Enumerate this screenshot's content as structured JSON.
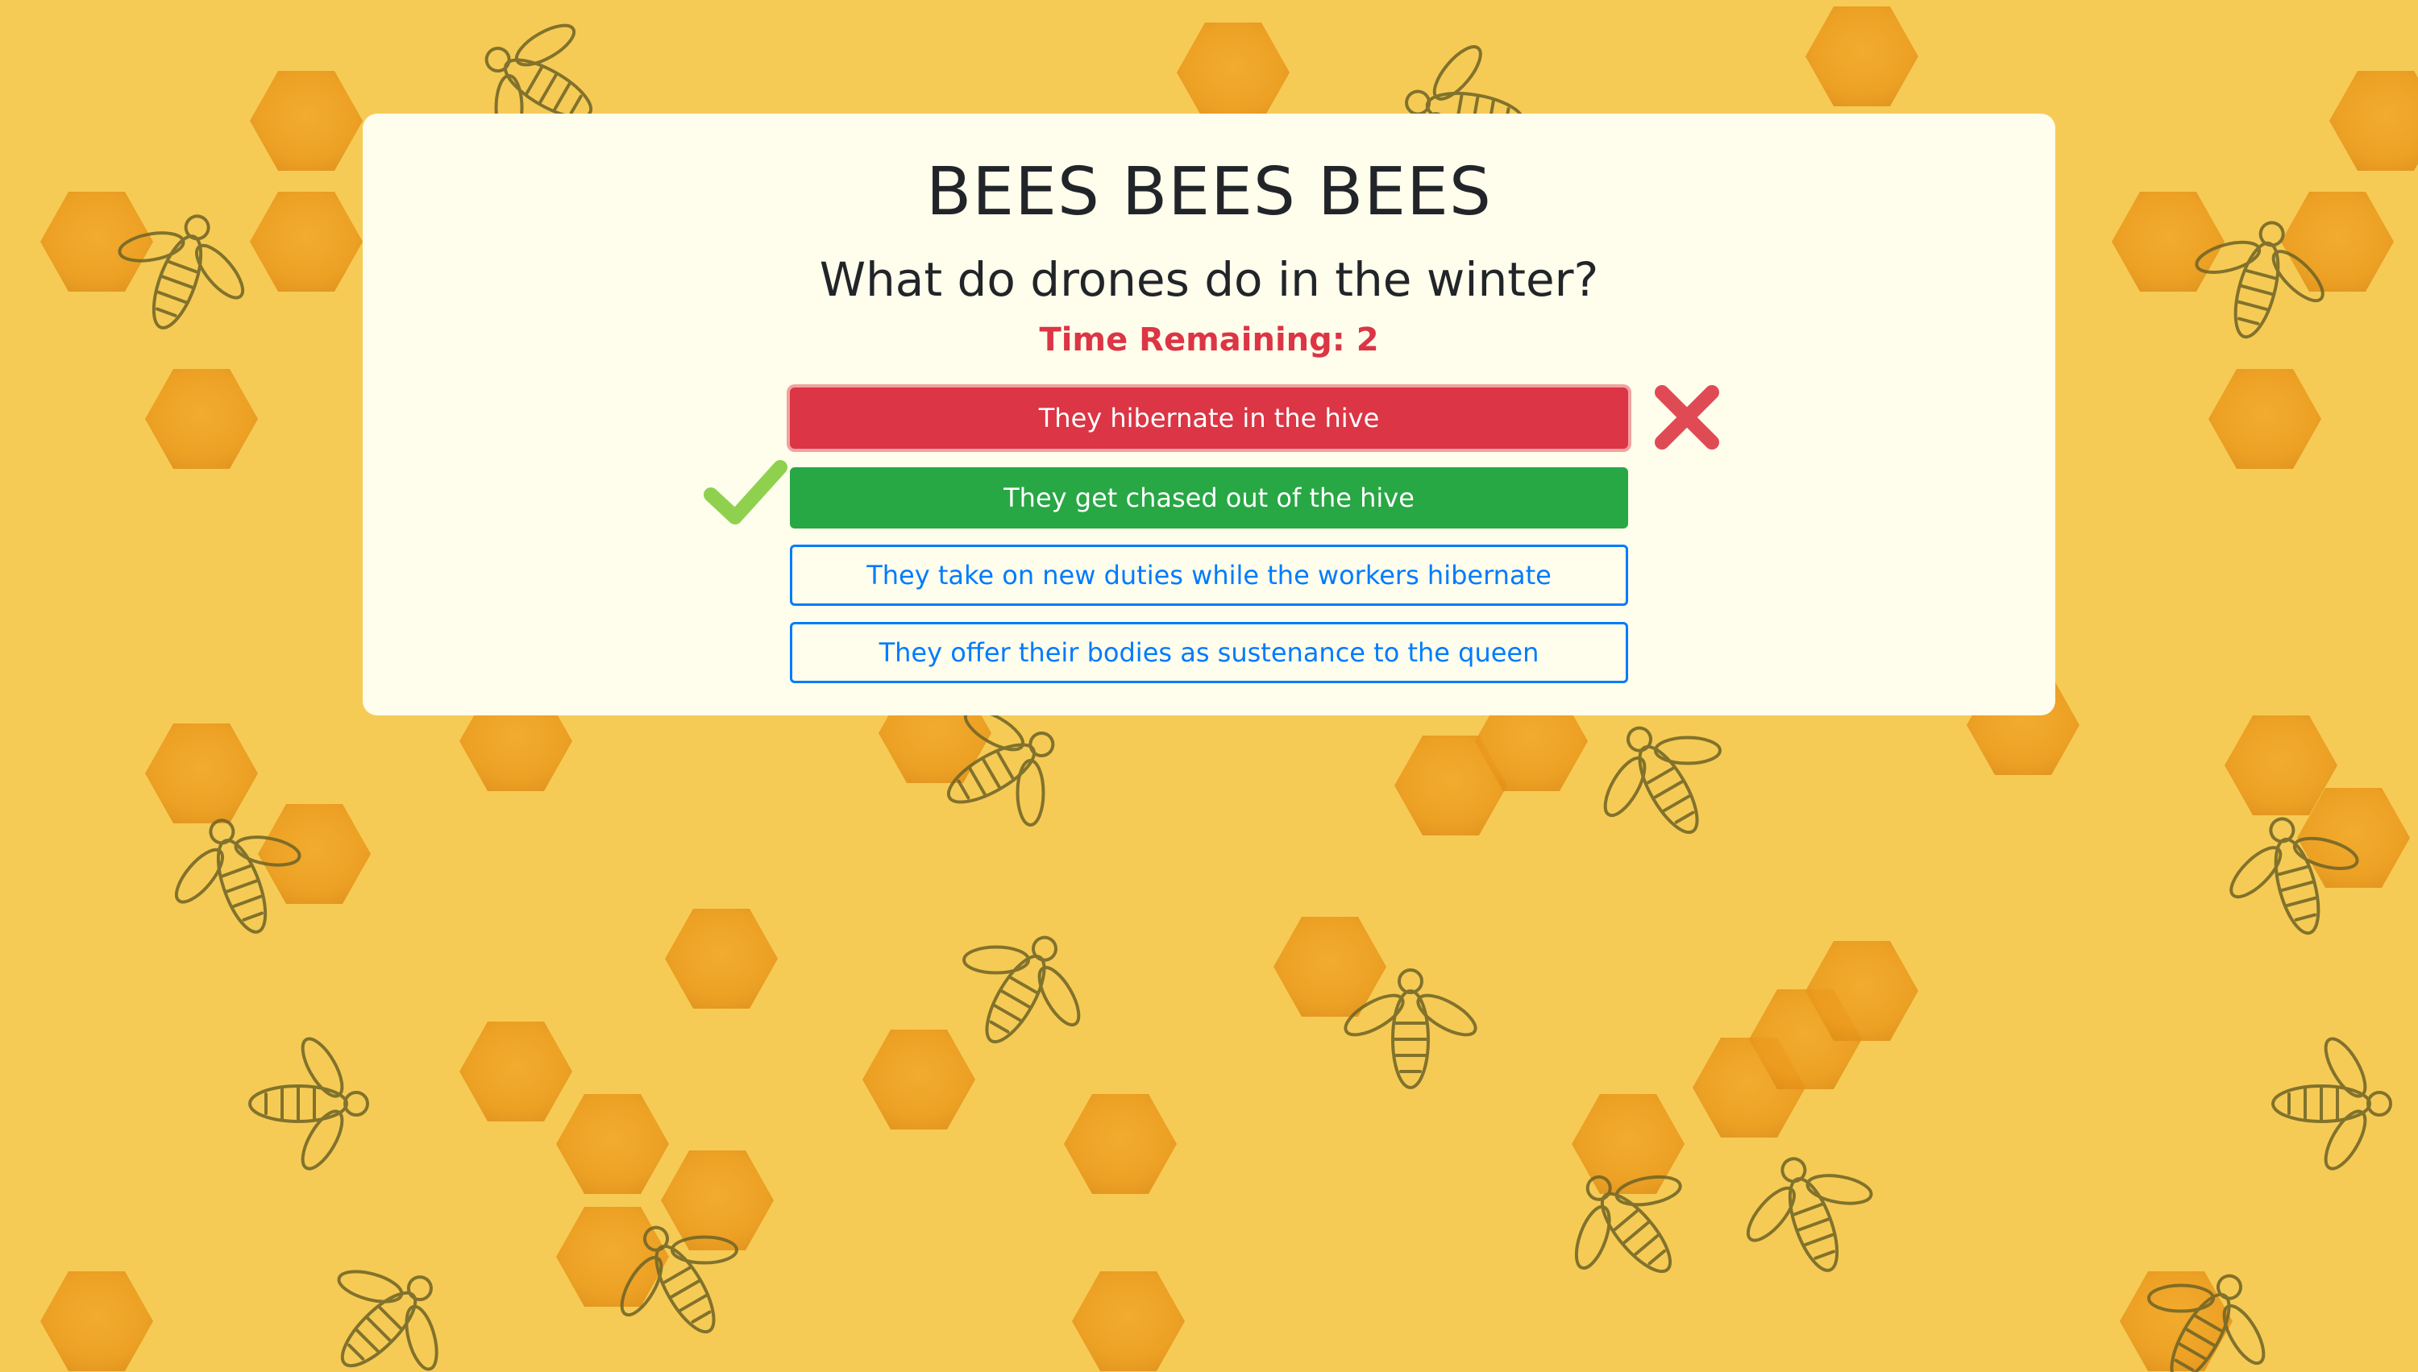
{
  "app": {
    "title": "BEES BEES BEES"
  },
  "quiz": {
    "question": "What do drones do in the winter?",
    "timer_label": "Time Remaining:",
    "time_remaining": "2",
    "answers": [
      {
        "label": "They hibernate in the hive",
        "state": "wrong-selected"
      },
      {
        "label": "They get chased out of the hive",
        "state": "correct"
      },
      {
        "label": "They take on new duties while the workers hibernate",
        "state": "neutral"
      },
      {
        "label": "They offer their bodies as sustenance to the queen",
        "state": "neutral"
      }
    ]
  },
  "colors": {
    "background": "#f6cb55",
    "card": "#fffdec",
    "wrong": "#dc3545",
    "correct": "#28a745",
    "neutral": "#007bff",
    "check_icon": "#8fd14f",
    "x_icon": "#e04a54"
  },
  "icons": {
    "wrong_marker": "x-mark-icon",
    "correct_marker": "check-mark-icon"
  }
}
